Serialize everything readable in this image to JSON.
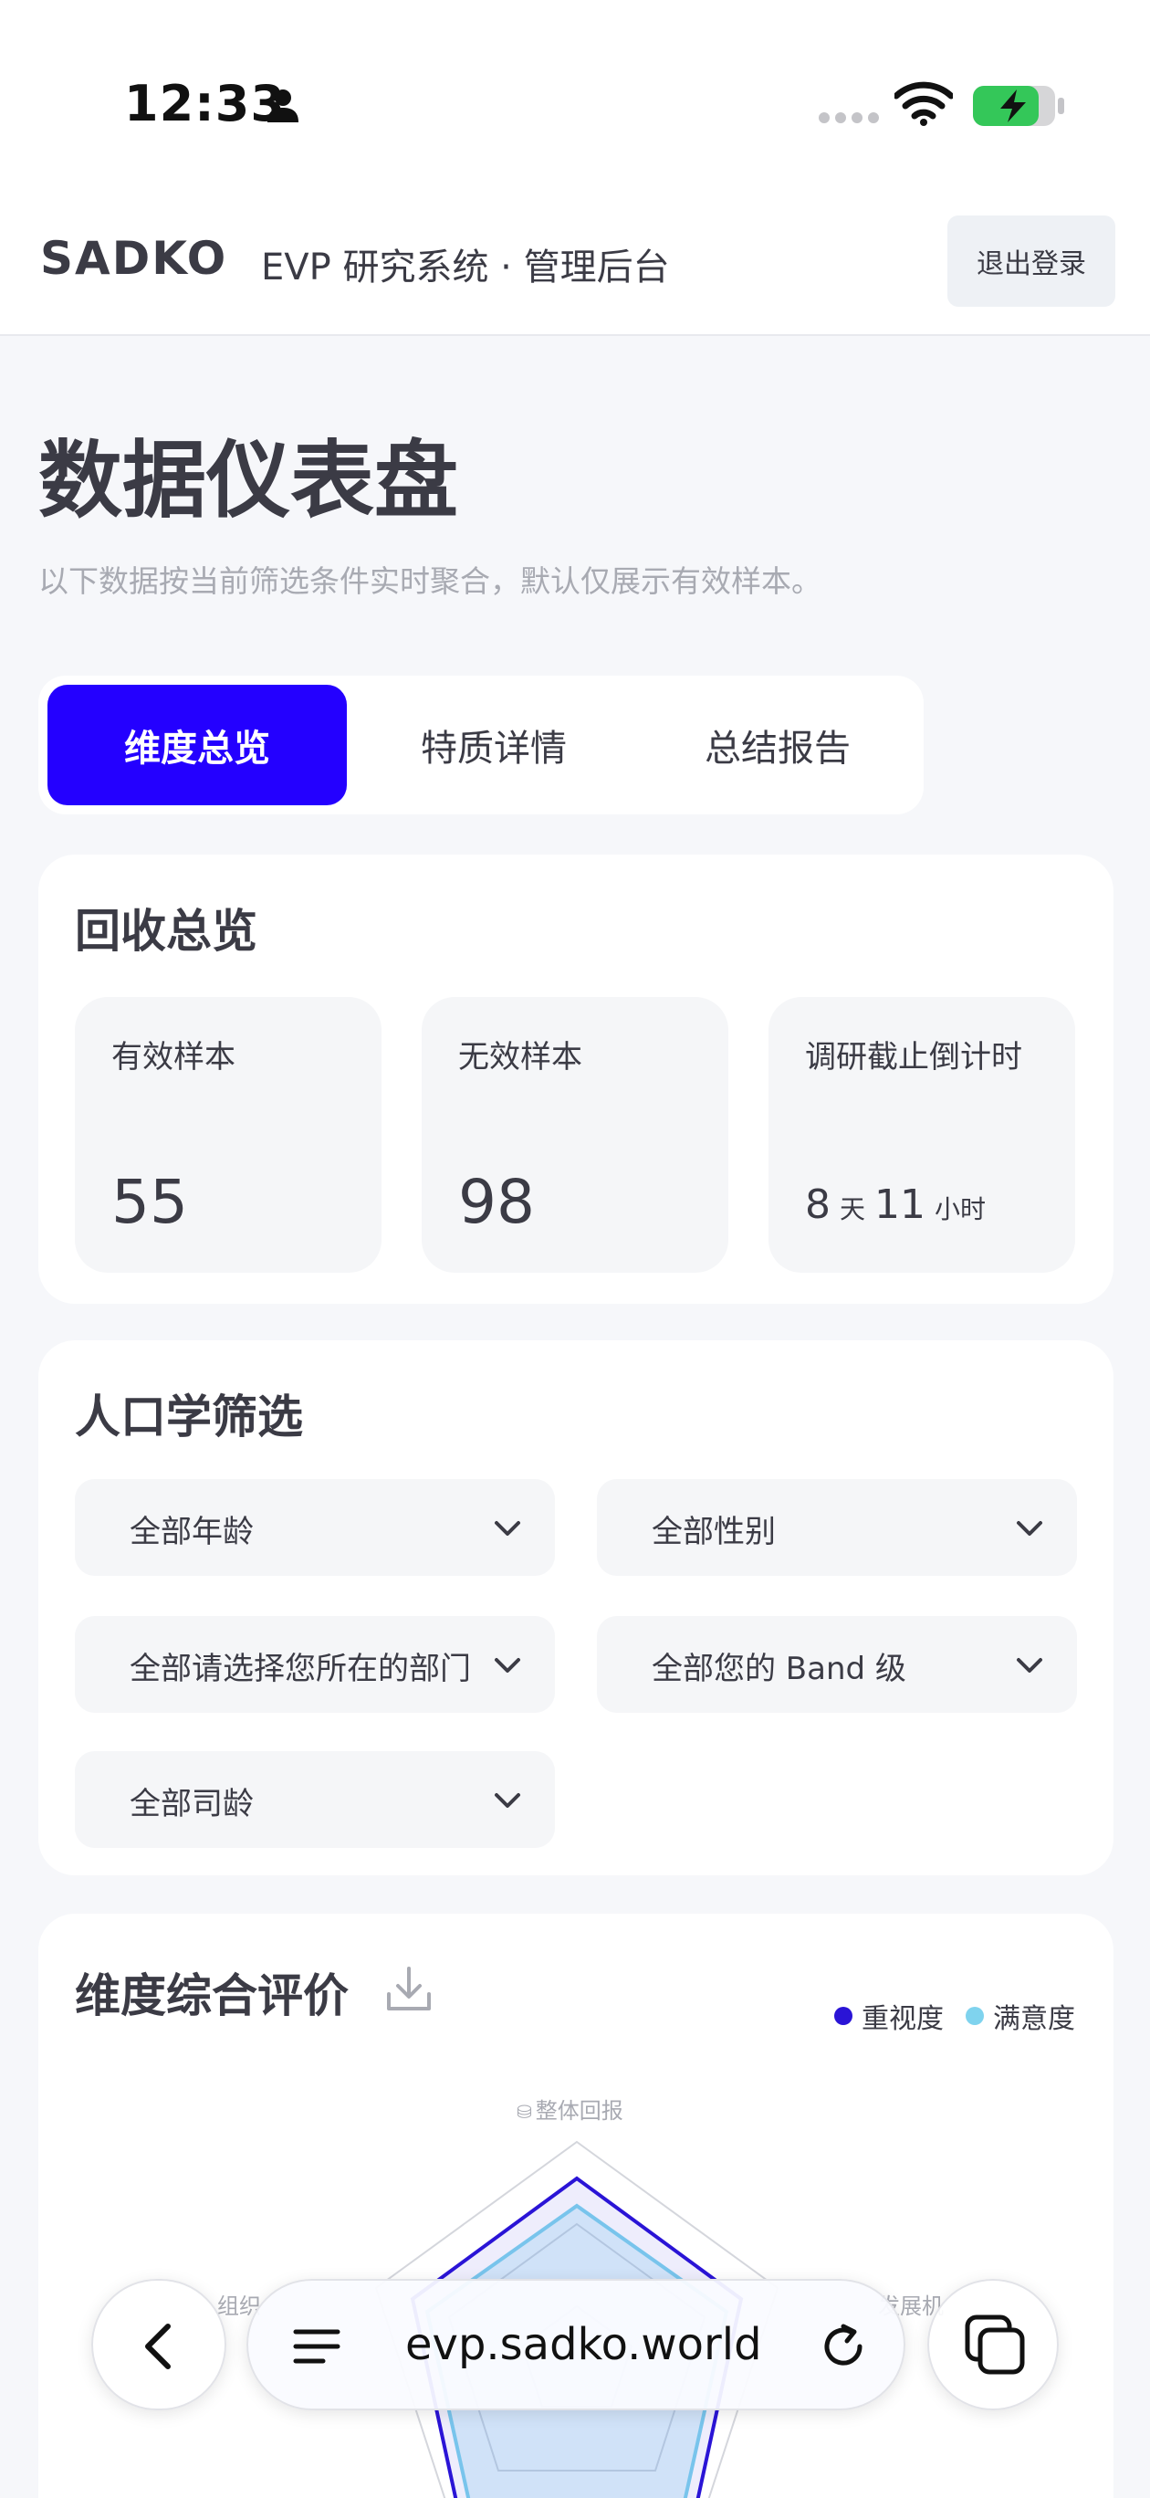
{
  "status_bar": {
    "time": "12:33"
  },
  "header": {
    "logo": "SADKO",
    "title": "EVP 研究系统 · 管理后台",
    "logout_label": "退出登录"
  },
  "page": {
    "title": "数据仪表盘",
    "subtitle": "以下数据按当前筛选条件实时聚合，默认仅展示有效样本。"
  },
  "tabs": [
    {
      "label": "维度总览",
      "active": true
    },
    {
      "label": "特质详情",
      "active": false
    },
    {
      "label": "总结报告",
      "active": false
    }
  ],
  "collection": {
    "title": "回收总览",
    "valid_label": "有效样本",
    "valid_value": "55",
    "invalid_label": "无效样本",
    "invalid_value": "98",
    "countdown_label": "调研截止倒计时",
    "countdown_days": "8",
    "days_unit": "天",
    "countdown_hours": "11",
    "hours_unit": "小时"
  },
  "filters": {
    "title": "人口学筛选",
    "options": [
      "全部年龄",
      "全部性别",
      "全部请选择您所在的部门",
      "全部您的 Band 级",
      "全部司龄"
    ]
  },
  "evaluation": {
    "title": "维度综合评价",
    "legend_importance": "重视度",
    "legend_satisfaction": "满意度",
    "axis_top": "整体回报",
    "axis_left": "组织",
    "axis_right": "发展机"
  },
  "colors": {
    "accent": "#2400ff",
    "importance": "#2a14d6",
    "satisfaction": "#7fd3ee"
  },
  "browser": {
    "url": "evp.sadko.world"
  }
}
